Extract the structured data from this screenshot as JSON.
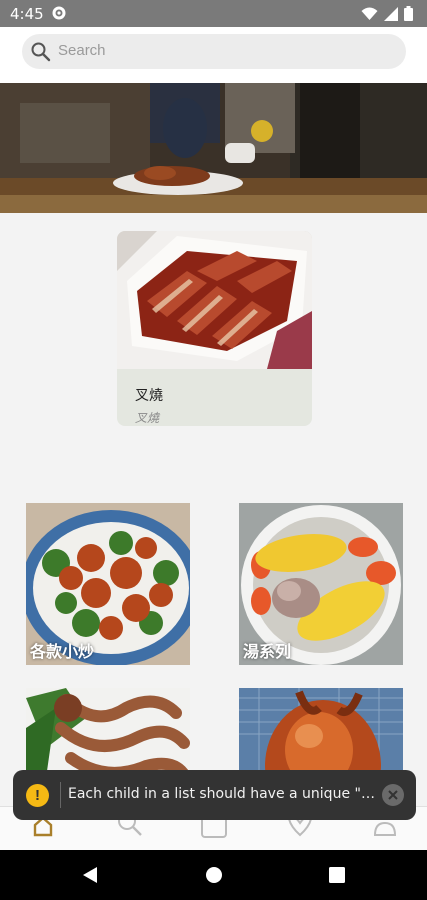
{
  "status_bar": {
    "time": "4:45"
  },
  "search": {
    "placeholder": "Search"
  },
  "featured": {
    "title": "叉燒",
    "subtitle": "叉燒"
  },
  "categories": [
    {
      "label": "各款小炒"
    },
    {
      "label": "湯系列"
    },
    {
      "label": ""
    },
    {
      "label": ""
    }
  ],
  "toast": {
    "message": "Each child in a list should have a unique \"key\" prop."
  },
  "colors": {
    "status_bar": "#7a7a7a",
    "toast_bg": "#333333",
    "warning": "#f5b914",
    "background": "#f3f3f3"
  }
}
